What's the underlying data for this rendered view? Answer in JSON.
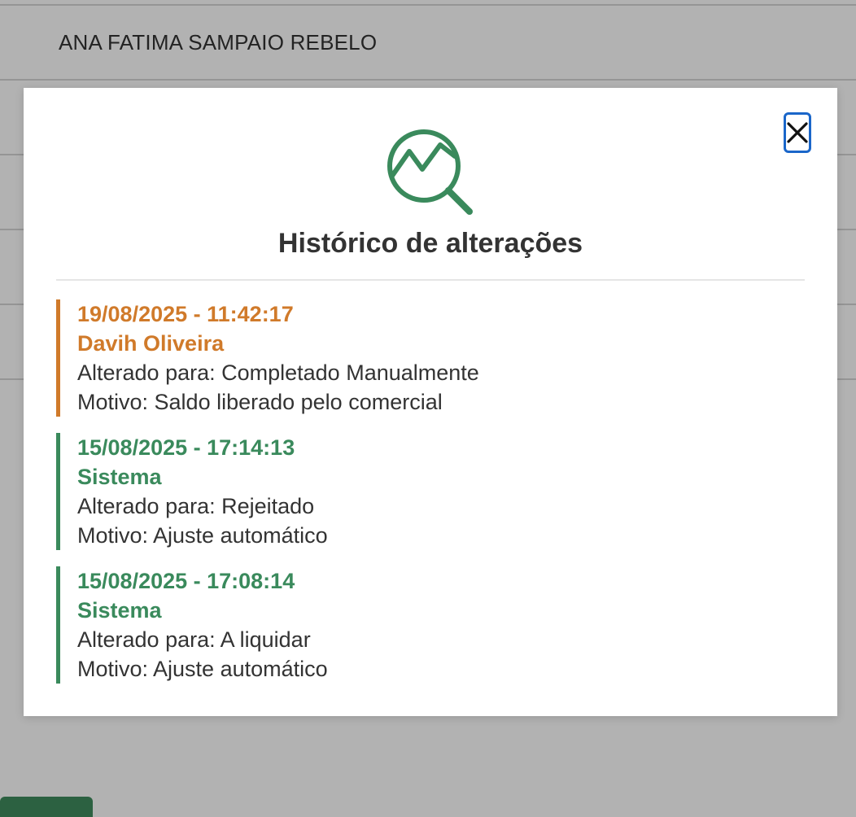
{
  "background": {
    "row_name": "ANA FATIMA SAMPAIO REBELO"
  },
  "modal": {
    "title": "Histórico de alterações",
    "icon": "chart-search-icon",
    "close_icon": "close-icon",
    "accent_color": "#3a8a5c",
    "highlight_color": "#d07a2a",
    "entries": [
      {
        "datetime": "19/08/2025 - 11:42:17",
        "author": "Davih Oliveira",
        "changed_to": "Alterado para: Completado Manualmente",
        "reason": "Motivo: Saldo liberado pelo comercial",
        "highlight": true
      },
      {
        "datetime": "15/08/2025 - 17:14:13",
        "author": "Sistema",
        "changed_to": "Alterado para: Rejeitado",
        "reason": "Motivo: Ajuste automático",
        "highlight": false
      },
      {
        "datetime": "15/08/2025 - 17:08:14",
        "author": "Sistema",
        "changed_to": "Alterado para: A liquidar",
        "reason": "Motivo: Ajuste automático",
        "highlight": false
      }
    ]
  }
}
